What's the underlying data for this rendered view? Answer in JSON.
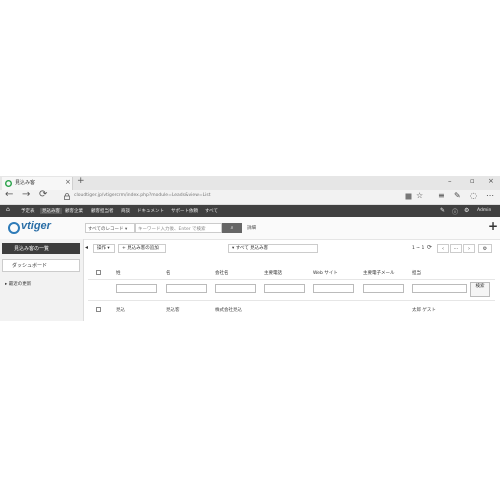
{
  "browser": {
    "tab_title": "見込み客",
    "tab_close": "×",
    "new_tab": "+",
    "url": "cloudtiger.jp/vtigercrm/index.php?module=Leads&view=List",
    "back_icon": "←",
    "forward_icon": "→",
    "refresh_icon": "⟳",
    "window_min": "–",
    "window_max": "▫",
    "window_close": "×"
  },
  "appnav": {
    "items": [
      {
        "label": "予定表",
        "active": false
      },
      {
        "label": "見込み客",
        "active": true
      },
      {
        "label": "顧客企業",
        "active": false
      },
      {
        "label": "顧客担当者",
        "active": false
      },
      {
        "label": "商談",
        "active": false
      },
      {
        "label": "ドキュメント",
        "active": false
      },
      {
        "label": "サポート依頼",
        "active": false
      },
      {
        "label": "すべて",
        "active": false
      }
    ],
    "user": "Admin"
  },
  "header": {
    "logo_text": "vtiger",
    "record_select": "すべてのレコード",
    "search_placeholder": "キーワード入力後、Enter で検索",
    "advanced_link": "詳細",
    "add_icon": "+"
  },
  "sidebar": {
    "active_label": "見込み客の一覧",
    "dashboard_label": "ダッシュボード",
    "recent_label": "最近の更新"
  },
  "toolbar": {
    "actions_label": "操作",
    "add_lead_label": "見込み客の追加",
    "filter_label": "すべて 見込み客",
    "pager_text": "1 ~ 1",
    "prev_icon": "‹",
    "next_icon": "›"
  },
  "table": {
    "columns": [
      "姓",
      "名",
      "会社名",
      "主要電話",
      "Web サイト",
      "主要電子メール",
      "担当"
    ],
    "search_label": "検索",
    "rows": [
      {
        "last_name": "見込",
        "first_name": "見込客",
        "company": "株式会社見込",
        "phone": "",
        "website": "",
        "email": "",
        "owner": "太郎 ゲスト"
      }
    ]
  },
  "colors": {
    "nav_bg": "#404040",
    "logo_blue": "#2a6ea6",
    "sidebar_active": "#3d3d3d"
  }
}
